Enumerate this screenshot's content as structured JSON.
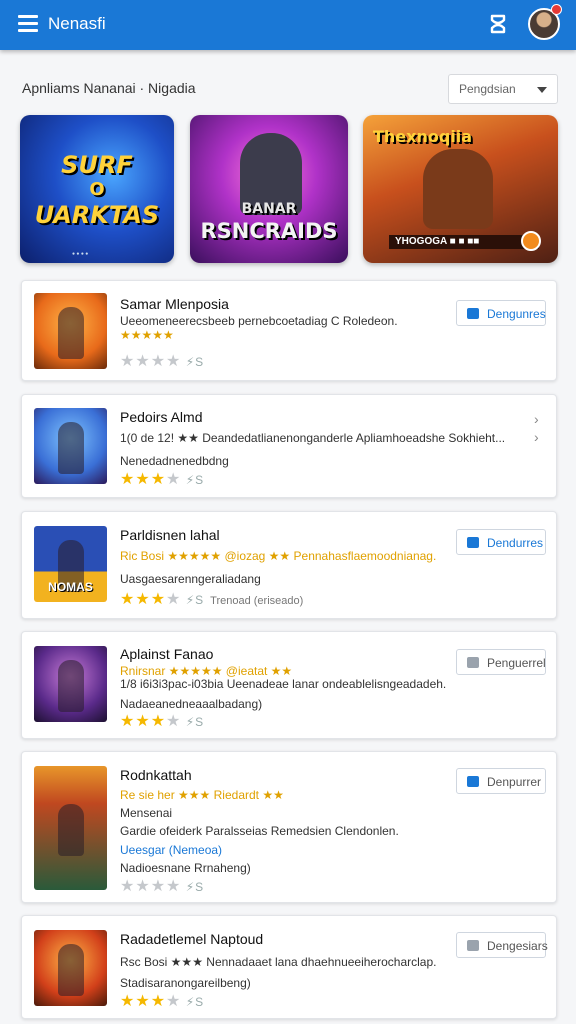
{
  "appbar": {
    "title": "Nenasfi"
  },
  "header": {
    "section_title": "Apnliams Nananai · Nigadia",
    "dropdown": "Pengdsian"
  },
  "featured": [
    {
      "line1": "SURF",
      "line2": "O",
      "line3": "UARKTAS",
      "tiny": "●  ●  ●  ●"
    },
    {
      "line1": "BANAR",
      "line2": "RSNCRAIDS"
    },
    {
      "line1": "Thexnoqiia",
      "bar": "YHOGOGA ■ ■ ■■"
    }
  ],
  "list": [
    {
      "title": "Samar Mlenposia",
      "line1": "Ueeomeneerecsbeeb pernebcoetadiag C Roledeon.",
      "line2": "★★★★★",
      "rating": {
        "filled": 0,
        "note": ""
      },
      "button": "Dengunres"
    },
    {
      "title": "Pedoirs Almd",
      "line1": "1(0 de 12! ★★ Deandedatlianenonganderle Apliamhoeadshe Sokhieht...",
      "line2": "Nenedadnenedbdng",
      "rating": {
        "filled": 3,
        "note": ""
      },
      "button": ""
    },
    {
      "title": "Parldisnen lahal",
      "line1": "Ric Bosi ★★★★★ @iozag ★★ Pennahasflaemoodnianag.",
      "line2": "Uasgaesarenngeraliadang",
      "rating": {
        "filled": 3,
        "note": "Trenoad (eriseado)"
      },
      "button": "Dendurres",
      "thumb_label": "NOMAS"
    },
    {
      "title": "Aplainst Fanao",
      "line1": "Rnirsnar ★★★★★ @ieatat ★★",
      "line2": "1/8 i6i3i3pac-i03bia Ueenadeae lanar ondeablelisngeadadeh.",
      "line3": "Nadaeanedneaaalbadang)",
      "rating": {
        "filled": 3,
        "note": ""
      },
      "button": "Penguerrel"
    },
    {
      "title": "Rodnkattah",
      "line1": "Re sie her ★★★ Riedardt ★★",
      "line2": "Mensenai",
      "line3": "Gardie ofeiderk Paralsseias Remedsien Clendonlen.",
      "line4": "Ueesgar (Nemeoa)",
      "line5": "Nadioesnane Rrnaheng)",
      "rating": {
        "filled": 0,
        "note": ""
      },
      "button": "Denpurrer"
    },
    {
      "title": "Radadetlemel Naptoud",
      "line1": "Rsc Bosi ★★★ Nennadaaet lana dhaehnueeiherocharclap.",
      "line2": "Stadisaranongareilbeng)",
      "rating": {
        "filled": 3,
        "note": ""
      },
      "button": "Dengesiars"
    }
  ]
}
